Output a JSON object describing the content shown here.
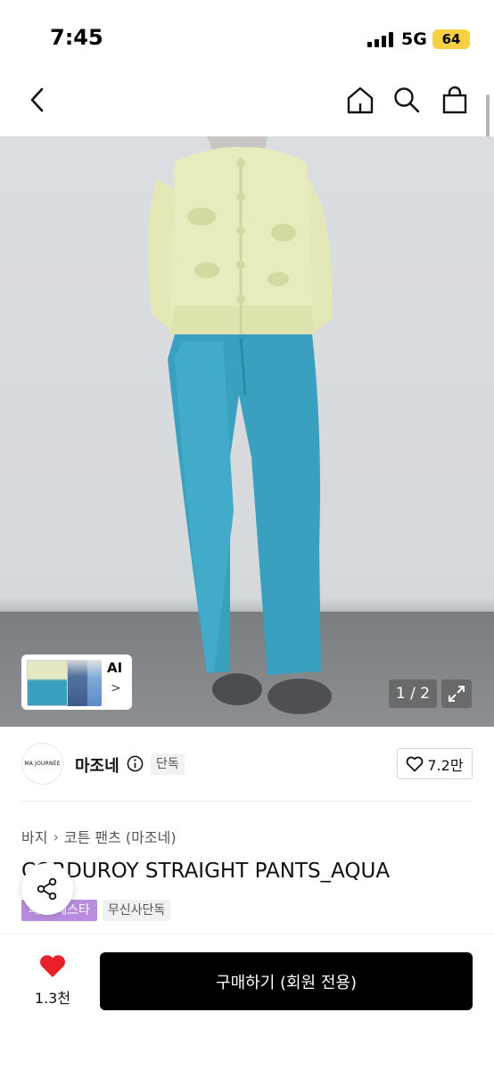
{
  "status_bar": {
    "time": "7:45",
    "network": "5G",
    "battery": "64"
  },
  "nav": {
    "back_icon": "chevron-left-icon",
    "home_icon": "home-icon",
    "search_icon": "search-icon",
    "bag_icon": "shopping-bag-icon"
  },
  "gallery": {
    "ai_label": "AI",
    "ai_chevron": ">",
    "page_counter": "1 / 2",
    "expand_icon": "expand-icon"
  },
  "brand": {
    "logo_text": "MA JOURNÉE",
    "name": "마조네",
    "exclusive_badge": "단독",
    "like_count": "7.2만"
  },
  "product": {
    "breadcrumb": [
      "바지",
      "코튼 팬츠 (마조네)"
    ],
    "title": "CORDUROY STRAIGHT PANTS_AQUA",
    "tags": [
      "패션 페스타",
      "무신사단독"
    ]
  },
  "bottom_bar": {
    "like_count": "1.3천",
    "buy_label": "구매하기 (회원 전용)"
  },
  "colors": {
    "buy_button": "#000000",
    "heart": "#e8202a",
    "tag_purple": "#b98ce0",
    "battery": "#f5d142"
  }
}
